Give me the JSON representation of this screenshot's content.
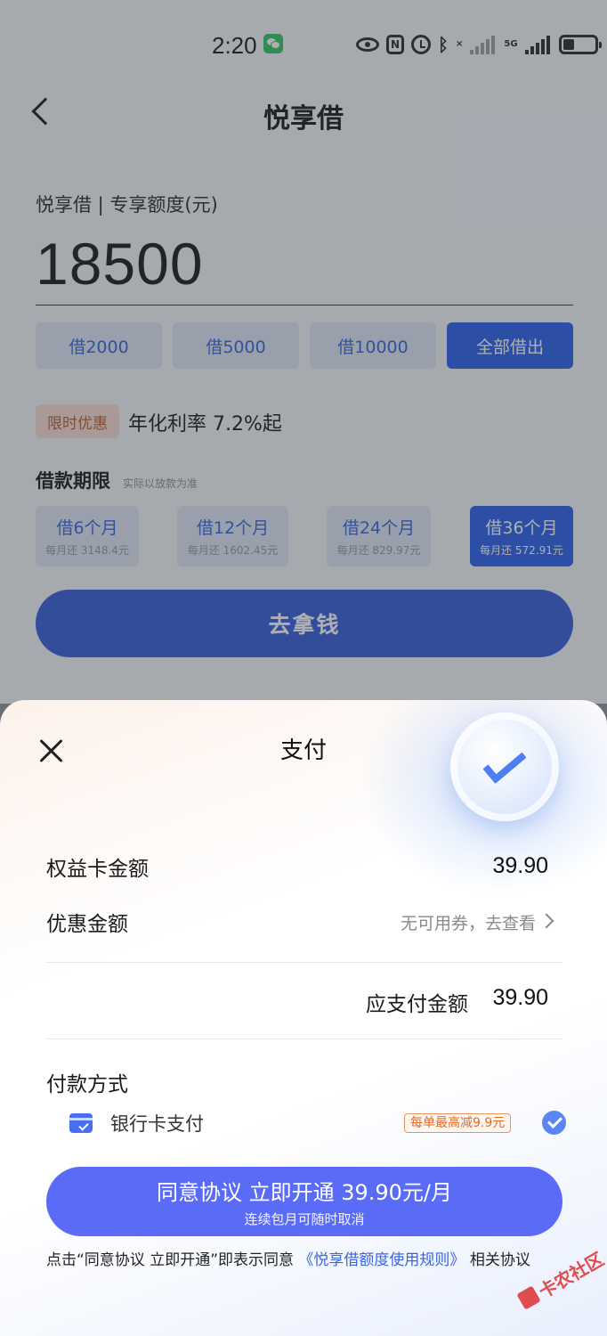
{
  "status_bar": {
    "time": "2:20",
    "sig_label_1": "×",
    "sig_label_2": "5G"
  },
  "nav": {
    "title": "悦享借"
  },
  "quota": {
    "label": "悦享借 | 专享额度(元)",
    "value": "18500"
  },
  "amount_options": [
    {
      "label": "借2000",
      "active": false
    },
    {
      "label": "借5000",
      "active": false
    },
    {
      "label": "借10000",
      "active": false
    },
    {
      "label": "全部借出",
      "active": true
    }
  ],
  "promo": {
    "badge": "限时优惠",
    "rate": "年化利率 7.2%起"
  },
  "term": {
    "title": "借款期限",
    "note": "实际以放款为准",
    "options": [
      {
        "label": "借6个月",
        "monthly": "每月还 3148.4元",
        "active": false
      },
      {
        "label": "借12个月",
        "monthly": "每月还 1602.45元",
        "active": false
      },
      {
        "label": "借24个月",
        "monthly": "每月还 829.97元",
        "active": false
      },
      {
        "label": "借36个月",
        "monthly": "每月还 572.91元",
        "active": true
      }
    ]
  },
  "go_button": "去拿钱",
  "sheet": {
    "title": "支付",
    "card_amount_label": "权益卡金额",
    "card_amount_value": "39.90",
    "discount_label": "优惠金额",
    "discount_value": "无可用券，去查看",
    "payable_label": "应支付金额",
    "payable_value": "39.90",
    "pay_method_title": "付款方式",
    "pay_method_label": "银行卡支付",
    "pay_method_tag": "每单最高减9.9元",
    "confirm_main": "同意协议 立即开通 39.90元/月",
    "confirm_sub": "连续包月可随时取消",
    "agreement_prefix": "点击“同意协议 立即开通”即表示同意 ",
    "agreement_link": "《悦享借额度使用规则》",
    "agreement_suffix": " 相关协议"
  },
  "watermark": "卡农社区",
  "colors": {
    "primary": "#2159e8",
    "confirm": "#5a6cf7",
    "promo_bg": "#f7ddd0",
    "tag": "#e06a2a"
  }
}
